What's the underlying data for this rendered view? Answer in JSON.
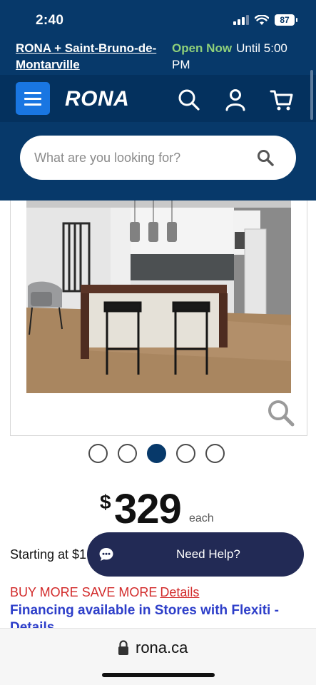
{
  "status_bar": {
    "time": "2:40",
    "battery": "87"
  },
  "store": {
    "name": "RONA + Saint-Bruno-de-Montarville",
    "open_status": "Open Now",
    "hours": "Until 5:00 PM"
  },
  "nav": {
    "logo": "RONA",
    "icons": [
      "menu-icon",
      "search-icon",
      "user-icon",
      "cart-icon"
    ]
  },
  "search": {
    "placeholder": "What are you looking for?"
  },
  "gallery": {
    "slide_count": 5,
    "active_index": 2
  },
  "product": {
    "currency_symbol": "$",
    "price": "329",
    "unit": "each",
    "starting_at": "Starting at $1"
  },
  "promo": {
    "text": "BUY MORE SAVE MORE",
    "link": "Details"
  },
  "financing": {
    "text": "Financing available in Stores with Flexiti - Details"
  },
  "help": {
    "label": "Need Help?"
  },
  "browser": {
    "url": "rona.ca"
  },
  "colors": {
    "header": "#07396a",
    "menu_button": "#1976e2",
    "open_now": "#8fd07a",
    "help_button": "#222a55",
    "promo": "#d22a2a",
    "financing": "#2d3ec9"
  }
}
